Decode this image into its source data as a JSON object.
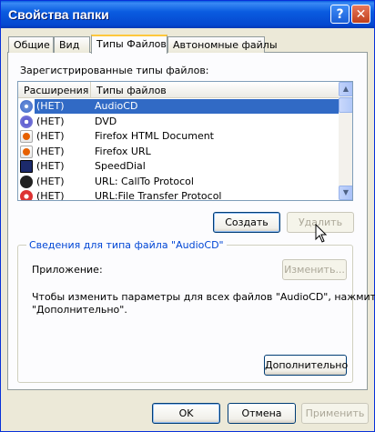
{
  "window": {
    "title": "Свойства папки",
    "help_glyph": "?",
    "close_glyph": "✕"
  },
  "tabs": [
    {
      "label": "Общие"
    },
    {
      "label": "Вид"
    },
    {
      "label": "Типы Файлов"
    },
    {
      "label": "Автономные файлы"
    }
  ],
  "active_tab": "Типы Файлов",
  "file_types": {
    "section_label": "Зарегистрированные типы файлов:",
    "columns": [
      "Расширения",
      "Типы файлов"
    ],
    "rows": [
      {
        "ext": "(НЕТ)",
        "type": "AudioCD",
        "icon": "audio-cd-icon",
        "selected": true
      },
      {
        "ext": "(НЕТ)",
        "type": "DVD",
        "icon": "dvd-icon",
        "selected": false
      },
      {
        "ext": "(НЕТ)",
        "type": "Firefox HTML Document",
        "icon": "firefox-doc-icon",
        "selected": false
      },
      {
        "ext": "(НЕТ)",
        "type": "Firefox URL",
        "icon": "firefox-url-icon",
        "selected": false
      },
      {
        "ext": "(НЕТ)",
        "type": "SpeedDial",
        "icon": "speeddial-icon",
        "selected": false
      },
      {
        "ext": "(НЕТ)",
        "type": "URL: CallTo Protocol",
        "icon": "callto-icon",
        "selected": false
      },
      {
        "ext": "(НЕТ)",
        "type": "URL:File Transfer Protocol",
        "icon": "ftp-icon",
        "selected": false
      }
    ],
    "scroll_up_glyph": "▲",
    "scroll_down_glyph": "▼"
  },
  "buttons": {
    "create": "Создать",
    "delete": "Удалить",
    "change": "Изменить...",
    "advanced": "Дополнительно",
    "ok": "OK",
    "cancel": "Отмена",
    "apply": "Применить"
  },
  "details": {
    "group_title": "Сведения для типа файла \"AudioCD\"",
    "app_label": "Приложение:",
    "hint_line1": "Чтобы изменить параметры для всех файлов \"AudioCD\", нажмите",
    "hint_line2": "\"Дополнительно\"."
  },
  "colors": {
    "titlebar": "#0a5ce0",
    "selection": "#316ac5",
    "group_title": "#0046d5"
  }
}
